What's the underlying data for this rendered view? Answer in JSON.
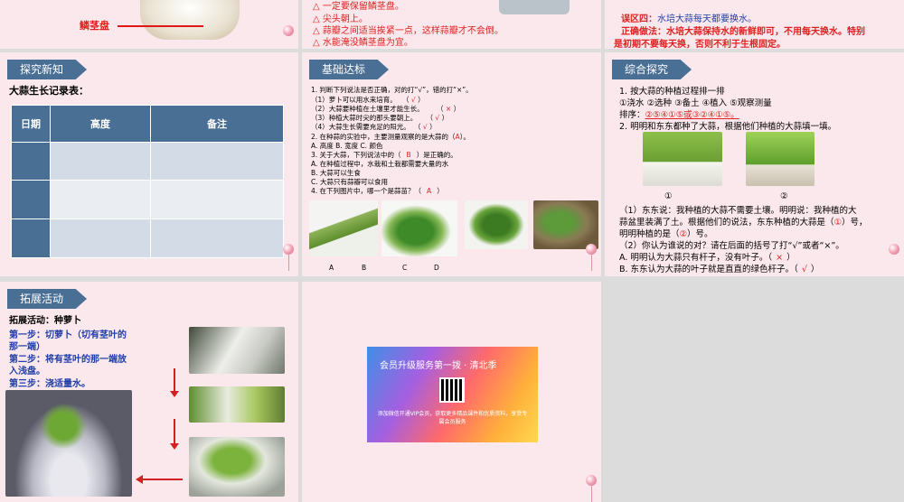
{
  "top_left": {
    "label": "鳞茎盘"
  },
  "top_mid": {
    "lines": [
      "△ 一定要保留鳞茎盘。",
      "△ 尖头朝上。",
      "△ 蒜瓣之间适当挨紧一点，这样蒜瓣才不会倒。",
      "△ 水能淹没鳞茎盘为宜。"
    ]
  },
  "top_right": {
    "line1_prefix": "误区四：",
    "line1_rest": "水培大蒜每天都要换水。",
    "line2_prefix": "正确做法：",
    "line2_rest": "水培大蒜保持水的新鲜即可，不用每天换水。特别",
    "line3": "是初期不要每天换，否则不利于生根固定。"
  },
  "slide1": {
    "header": "探究新知",
    "title": "大蒜生长记录表：",
    "table_headers": [
      "日期",
      "高度",
      "备注"
    ]
  },
  "slide2": {
    "header": "基础达标",
    "lines": [
      "1. 判断下列说法是否正确，对的打“√”，错的打“×”。",
      "（1）萝卜可以用水来培育。",
      "（2）大蒜要种植在土壤里才能生长。",
      "（3）种植大蒜时尖的那头要朝上。",
      "（4）大蒜生长需要充足的阳光。",
      "2. 在种蒜的实验中，主要测量观察的是大蒜的（",
      "A. 高度          B. 宽度          C. 颜色",
      "3. 关于大蒜，下列说法中的（",
      "A. 在种植过程中，水栽和土栽都需要大量的水",
      "B. 大蒜可以生食",
      "C. 大蒜只有蒜瓣可以食用",
      "4. 在下列图片中，哪一个是蒜苗？（"
    ],
    "answers": [
      "√",
      "×",
      "√",
      "√",
      "A",
      "B",
      "A"
    ],
    "close_paren": "）",
    "q2_tail": "）。",
    "q3_tail": "）是正确的。",
    "image_labels": [
      "A",
      "B",
      "C",
      "D"
    ]
  },
  "slide3": {
    "header": "综合探究",
    "q1": "1. 按大蒜的种植过程排一排",
    "steps": "①浇水      ②选种      ③备土      ④植入      ⑤观察测量",
    "order_label": "排序：",
    "order_answer": "②⑤④①⑤或③②④①⑤。",
    "q2": "2. 明明和东东都种了大蒜，根据他们种植的大蒜填一填。",
    "img_labels": [
      "①",
      "②"
    ],
    "p1": "（1）东东说：我种植的大蒜不需要土壤。明明说：我种植的大",
    "p2a": "蒜盆里装满了土。根据他们的说法，东东种植的大蒜是（",
    "p2_ans": "①",
    "p2b": "）号，",
    "p3a": "明明种植的是（",
    "p3_ans": "②",
    "p3b": "）号。",
    "p4": "（2）你认为谁说的对？请在后面的括号了打“√”或者“×”。",
    "optA": "A. 明明认为大蒜只有杆子，没有叶子。（",
    "optA_ans": "×",
    "optB": "B. 东东认为大蒜的叶子就是直直的绿色杆子。（",
    "optB_ans": "√",
    "close": "）"
  },
  "slide4": {
    "header": "拓展活动",
    "title": "拓展活动：种萝卜",
    "step1a": "第一步：切萝卜（切有茎叶的",
    "step1b": "那一端）",
    "step2a": "第二步：将有茎叶的那一端放",
    "step2b": "入浅盘。",
    "step3": "第三步：浇适量水。"
  },
  "slide5": {
    "banner_text": "会员升级服务第一拨 · 清北季",
    "fine_print": "添加微信开通VIP会员，获取更多精品课件和优质资料，享受专属会员服务"
  }
}
